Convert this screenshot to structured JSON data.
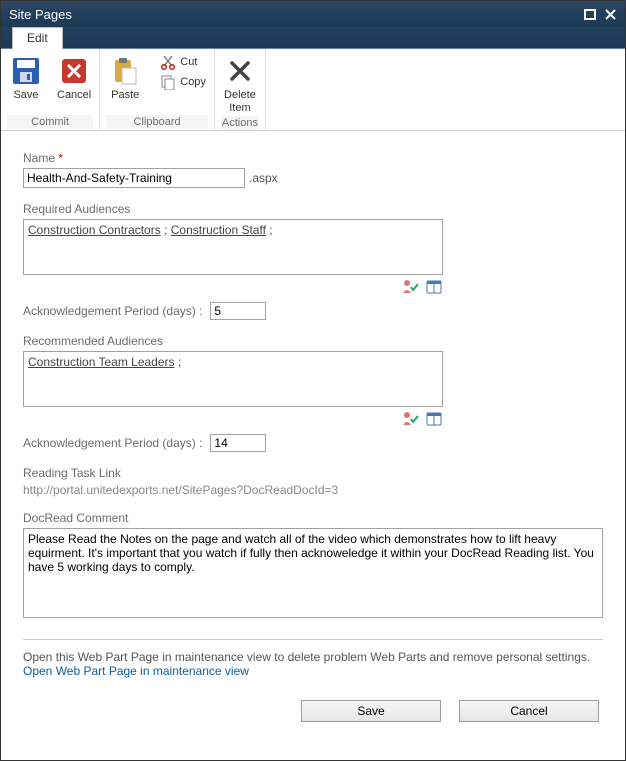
{
  "window": {
    "title": "Site Pages"
  },
  "tab": {
    "label": "Edit"
  },
  "ribbon": {
    "commit": {
      "label": "Commit",
      "save": "Save",
      "cancel": "Cancel"
    },
    "clipboard": {
      "label": "Clipboard",
      "paste": "Paste",
      "cut": "Cut",
      "copy": "Copy"
    },
    "actions": {
      "label": "Actions",
      "deleteItem": "Delete\nItem"
    }
  },
  "form": {
    "name": {
      "label": "Name",
      "value": "Health-And-Safety-Training",
      "suffix": ".aspx"
    },
    "requiredAudiences": {
      "label": "Required Audiences",
      "values": [
        "Construction Contractors",
        "Construction Staff"
      ],
      "ackLabel": "Acknowledgement Period (days)  :",
      "ackValue": "5"
    },
    "recommendedAudiences": {
      "label": "Recommended Audiences",
      "values": [
        "Construction Team Leaders"
      ],
      "ackLabel": "Acknowledgement Period (days)  :",
      "ackValue": "14"
    },
    "readingTaskLink": {
      "label": "Reading Task Link",
      "url": "http://portal.unitedexports.net/SitePages?DocReadDocId=3"
    },
    "docReadComment": {
      "label": "DocRead Comment",
      "value": "Please Read the Notes on the page and watch all of the video which demonstrates how to lift heavy equirment. It's important that you watch if fully then acknoweledge it within your DocRead Reading list. You have 5 working days to comply."
    },
    "maintenance": {
      "text": "Open this Web Part Page in maintenance view to delete problem Web Parts and remove personal settings.",
      "link": "Open Web Part Page in maintenance view"
    },
    "buttons": {
      "save": "Save",
      "cancel": "Cancel"
    }
  }
}
